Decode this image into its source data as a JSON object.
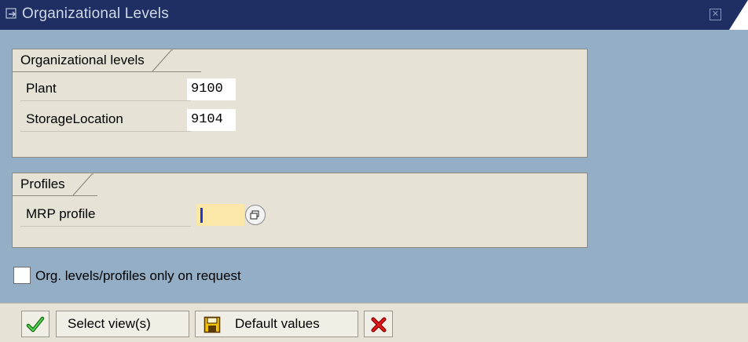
{
  "window": {
    "title": "Organizational Levels"
  },
  "org_levels": {
    "group_title": "Organizational levels",
    "plant": {
      "label": "Plant",
      "value": "9100"
    },
    "storage_location": {
      "label": "StorageLocation",
      "value": "9104"
    }
  },
  "profiles": {
    "group_title": "Profiles",
    "mrp_profile": {
      "label": "MRP profile",
      "value": ""
    }
  },
  "options": {
    "only_on_request_label": "Org. levels/profiles only on request",
    "only_on_request_checked": false
  },
  "toolbar": {
    "continue_icon": "green-check-icon",
    "select_views_label": "Select view(s)",
    "default_values_icon": "save-icon",
    "default_values_label": "Default values",
    "cancel_icon": "red-x-icon"
  },
  "colors": {
    "title_bar": "#1f2f63",
    "background": "#94aec6",
    "group_bg": "#e6e2d6",
    "required_field": "#fbe7a8"
  }
}
